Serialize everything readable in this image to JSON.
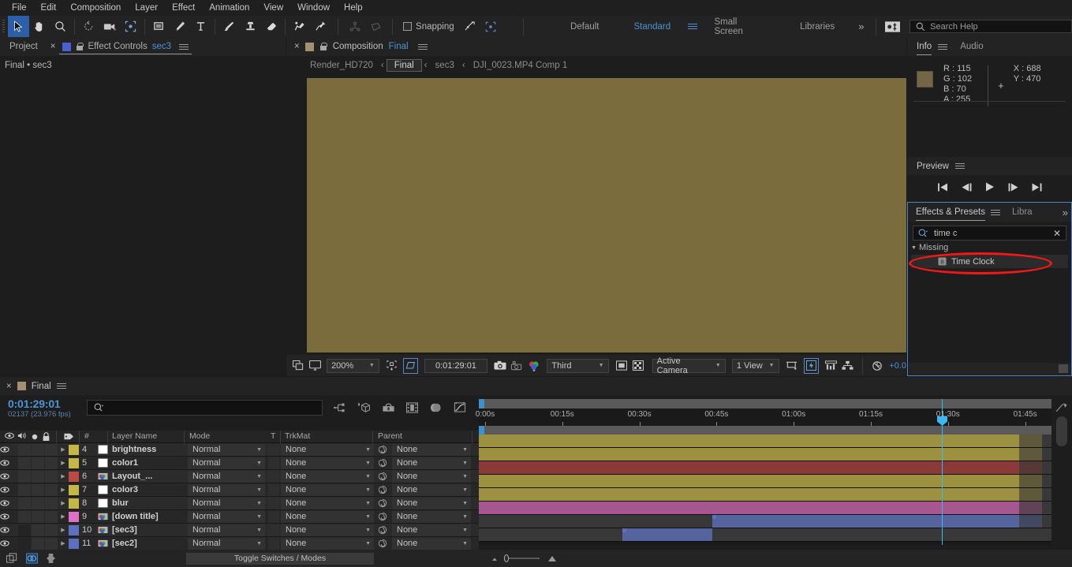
{
  "menu": {
    "items": [
      "File",
      "Edit",
      "Composition",
      "Layer",
      "Effect",
      "Animation",
      "View",
      "Window",
      "Help"
    ]
  },
  "toolbar": {
    "snapping_label": "Snapping",
    "workspaces": [
      "Default",
      "Standard",
      "Small Screen",
      "Libraries"
    ],
    "selected_workspace": "Standard",
    "overflow_label": "»",
    "search_help_placeholder": "Search Help"
  },
  "project_panel": {
    "tab_project": "Project",
    "tab_effect_controls": "Effect Controls",
    "effect_controls_target": "sec3",
    "breadcrumb": "Final • sec3"
  },
  "composition_panel": {
    "tab_label": "Composition",
    "comp_name": "Final",
    "breadcrumbs": [
      "Render_HD720",
      "Final",
      "sec3",
      "DJI_0023.MP4 Comp 1"
    ],
    "active_breadcrumb": "Final",
    "viewer_color": "#7b6c3d",
    "toolbar": {
      "zoom": "200%",
      "timecode": "0:01:29:01",
      "resolution": "Third",
      "camera": "Active Camera",
      "views": "1 View",
      "exposure": "+0.0"
    }
  },
  "info_panel": {
    "tab_info": "Info",
    "tab_audio": "Audio",
    "color_swatch": "#736646",
    "r_label": "R :",
    "r_value": "115",
    "g_label": "G :",
    "g_value": "102",
    "b_label": "B :",
    "b_value": "70",
    "a_label": "A :",
    "a_value": "255",
    "x_label": "X :",
    "x_value": "688",
    "y_label": "Y :",
    "y_value": "470"
  },
  "preview_panel": {
    "title": "Preview"
  },
  "effects_panel": {
    "tab_effects": "Effects & Presets",
    "tab_libraries": "Libra",
    "search_value": "time c",
    "group_label": "Missing",
    "items": [
      {
        "label": "Time Clock"
      }
    ],
    "highlight_color": "#f01818"
  },
  "timeline": {
    "tab_label": "Final",
    "timecode": "0:01:29:01",
    "frame_info": "02137 (23.976 fps)",
    "search_placeholder": "",
    "columns": {
      "num": "#",
      "layer_name": "Layer Name",
      "mode": "Mode",
      "t": "T",
      "trkmat": "TrkMat",
      "parent": "Parent"
    },
    "toggle_switches_label": "Toggle Switches / Modes",
    "ruler_ticks": [
      "0:00s",
      "00:15s",
      "00:30s",
      "00:45s",
      "01:00s",
      "01:15s",
      "01:30s",
      "01:45s"
    ],
    "playhead_time": "01:30s",
    "layers": [
      {
        "num": "4",
        "name": "brightness",
        "color": "#c4b747",
        "mode": "Normal",
        "trkmat": "None",
        "parent": "None",
        "kind": "solid",
        "bar_color": "#9c9140",
        "bar_start_pct": 0,
        "bar_end_pct": 93.5
      },
      {
        "num": "5",
        "name": "color1",
        "color": "#c4b747",
        "mode": "Normal",
        "trkmat": "None",
        "parent": "None",
        "kind": "solid",
        "bar_color": "#9c9140",
        "bar_start_pct": 0,
        "bar_end_pct": 93.5
      },
      {
        "num": "6",
        "name": "Layout_...",
        "color": "#b94a46",
        "mode": "Normal",
        "trkmat": "None",
        "parent": "None",
        "kind": "comp",
        "bar_color": "#8a3a38",
        "bar_start_pct": 0,
        "bar_end_pct": 93.5
      },
      {
        "num": "7",
        "name": "color3",
        "color": "#c4b747",
        "mode": "Normal",
        "trkmat": "None",
        "parent": "None",
        "kind": "solid",
        "bar_color": "#9c9140",
        "bar_start_pct": 0,
        "bar_end_pct": 93.5
      },
      {
        "num": "8",
        "name": "blur",
        "color": "#c4b747",
        "mode": "Normal",
        "trkmat": "None",
        "parent": "None",
        "kind": "solid",
        "bar_color": "#9c9140",
        "bar_start_pct": 0,
        "bar_end_pct": 93.5
      },
      {
        "num": "9",
        "name": "[down title]",
        "color": "#e070c6",
        "mode": "Normal",
        "trkmat": "None",
        "parent": "None",
        "kind": "comp",
        "bar_color": "#a6578f",
        "bar_start_pct": 0,
        "bar_end_pct": 93.5
      },
      {
        "num": "10",
        "name": "[sec3]",
        "color": "#5d6fc0",
        "mode": "Normal",
        "trkmat": "None",
        "parent": "None",
        "kind": "comp",
        "bar_color": "#55639e",
        "bar_start_pct": 40.4,
        "bar_end_pct": 93.5
      },
      {
        "num": "11",
        "name": "[sec2]",
        "color": "#5d6fc0",
        "mode": "Normal",
        "trkmat": "None",
        "parent": "None",
        "kind": "comp",
        "bar_color": "#55639e",
        "bar_start_pct": 24.8,
        "bar_end_pct": 40.4
      }
    ]
  }
}
